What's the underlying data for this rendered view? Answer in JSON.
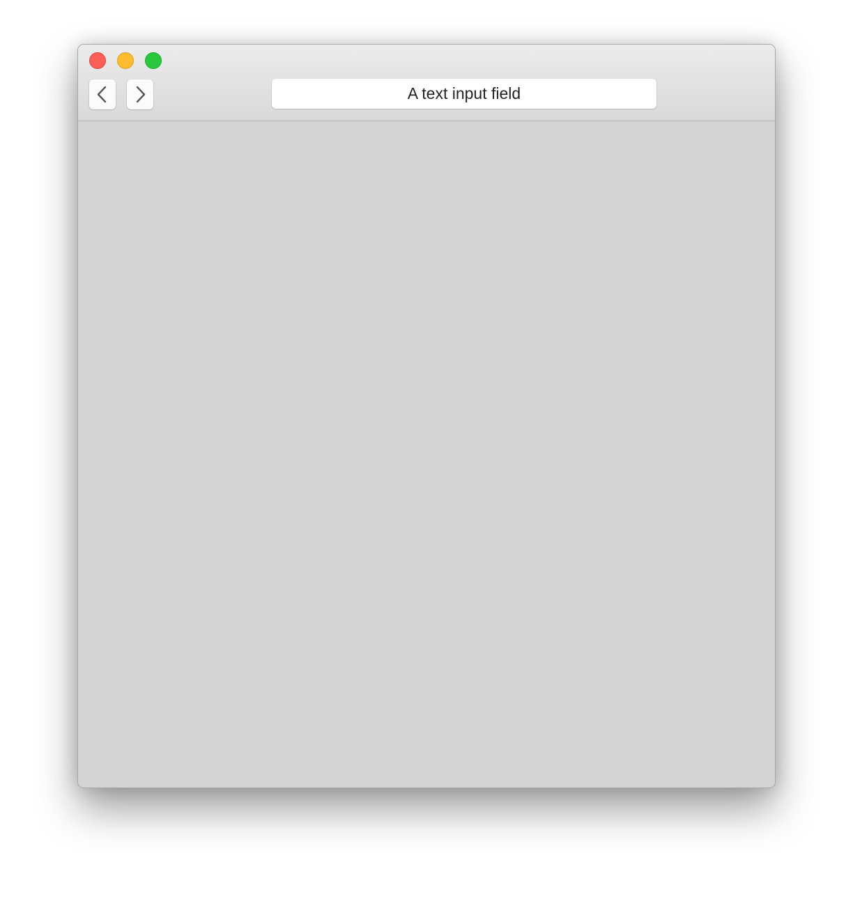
{
  "window": {
    "controls": [
      {
        "name": "close",
        "color": "#fc5f57"
      },
      {
        "name": "minimize",
        "color": "#fdbc2e"
      },
      {
        "name": "zoom",
        "color": "#29c83f"
      }
    ]
  },
  "toolbar": {
    "back_icon": "chevron-left-icon",
    "forward_icon": "chevron-right-icon",
    "text_field_value": "A text input field"
  },
  "content": {
    "background": "#d4d4d4"
  }
}
